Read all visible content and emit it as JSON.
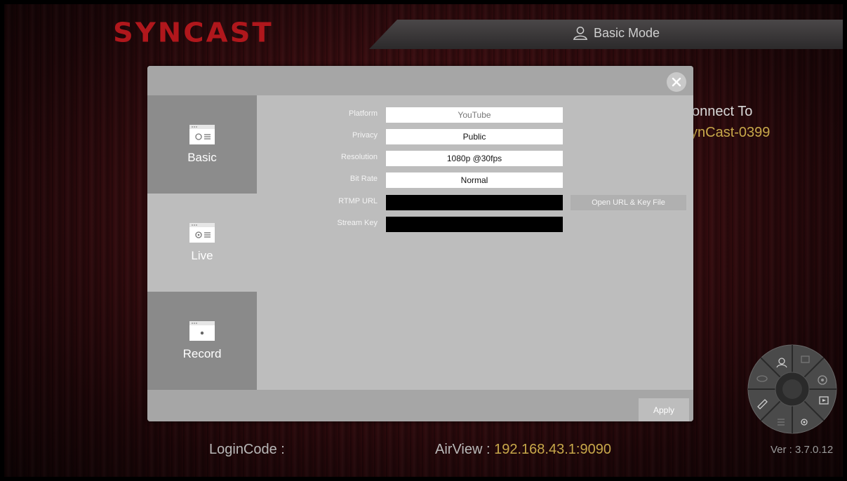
{
  "header": {
    "logo": "SYNCAST",
    "mode_label": "Basic Mode"
  },
  "connection": {
    "connect_to": "onnect To",
    "device": "ynCast-0399"
  },
  "footer": {
    "login_label": "LoginCode :",
    "airview_label": "AirView :",
    "airview_ip": "192.168.43.1:9090",
    "version": "Ver : 3.7.0.12"
  },
  "dialog": {
    "tabs": [
      {
        "label": "Basic",
        "icon": "settings-window-icon"
      },
      {
        "label": "Live",
        "icon": "live-window-icon"
      },
      {
        "label": "Record",
        "icon": "record-window-icon"
      }
    ],
    "selected_tab": "Live",
    "fields": {
      "platform": {
        "label": "Platform",
        "value": "YouTube"
      },
      "privacy": {
        "label": "Privacy",
        "value": "Public"
      },
      "resolution": {
        "label": "Resolution",
        "value": "1080p @30fps"
      },
      "bitrate": {
        "label": "Bit Rate",
        "value": "Normal"
      },
      "rtmp_url": {
        "label": "RTMP URL",
        "value": ""
      },
      "stream_key": {
        "label": "Stream Key",
        "value": ""
      }
    },
    "open_url_button": "Open URL & Key File",
    "apply_button": "Apply"
  },
  "colors": {
    "brand_red": "#b0171c",
    "gold_text": "#c8a84a",
    "dialog_gray": "#a9a9a9"
  }
}
